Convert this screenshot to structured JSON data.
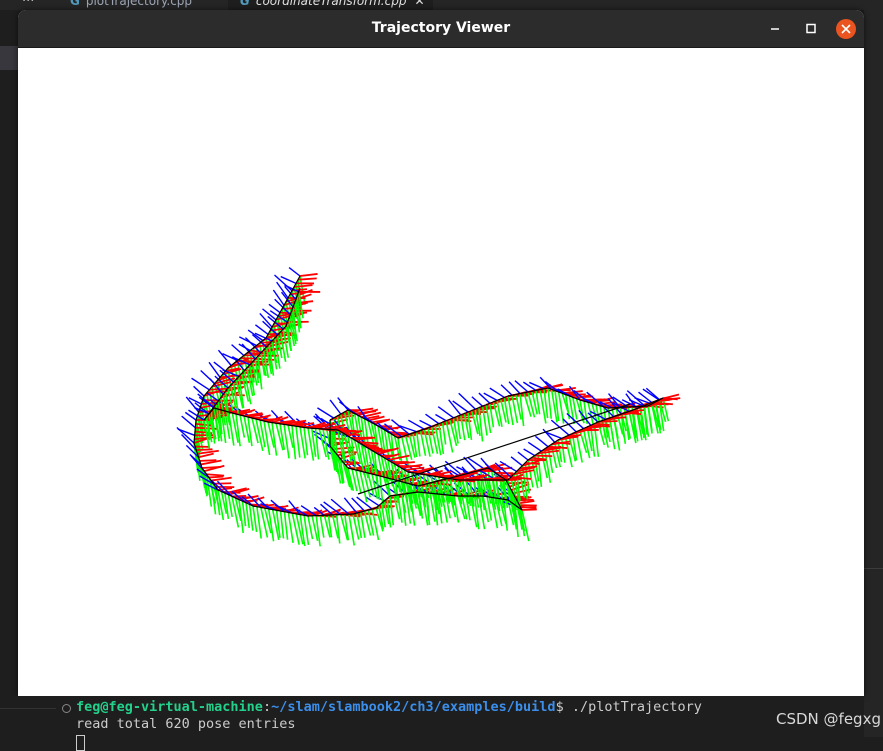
{
  "ide": {
    "dots": "···",
    "tabs": [
      {
        "icon": "G",
        "label": "plotTrajectory.cpp"
      },
      {
        "icon": "G",
        "label": "coordinateTransform.cpp",
        "close": "✕"
      }
    ]
  },
  "window": {
    "title": "Trajectory Viewer"
  },
  "terminal": {
    "user": "feg@feg-virtual-machine",
    "sep": ":",
    "path": "~/slam/slambook2/ch3/examples/build",
    "prompt": "$ ",
    "command": "./plotTrajectory",
    "output": "read total 620 pose entries"
  },
  "watermark": "CSDN @fegxg",
  "colors": {
    "x_axis": "#ff0000",
    "y_axis": "#00ff00",
    "z_axis": "#0000ff",
    "trajectory": "#000000",
    "close_button": "#e95420"
  },
  "chart_data": {
    "type": "line",
    "description_source": "3D camera pose trajectory with per-pose coordinate axes",
    "pose_count": 620,
    "title": "",
    "xlabel": "",
    "ylabel": ""
  }
}
